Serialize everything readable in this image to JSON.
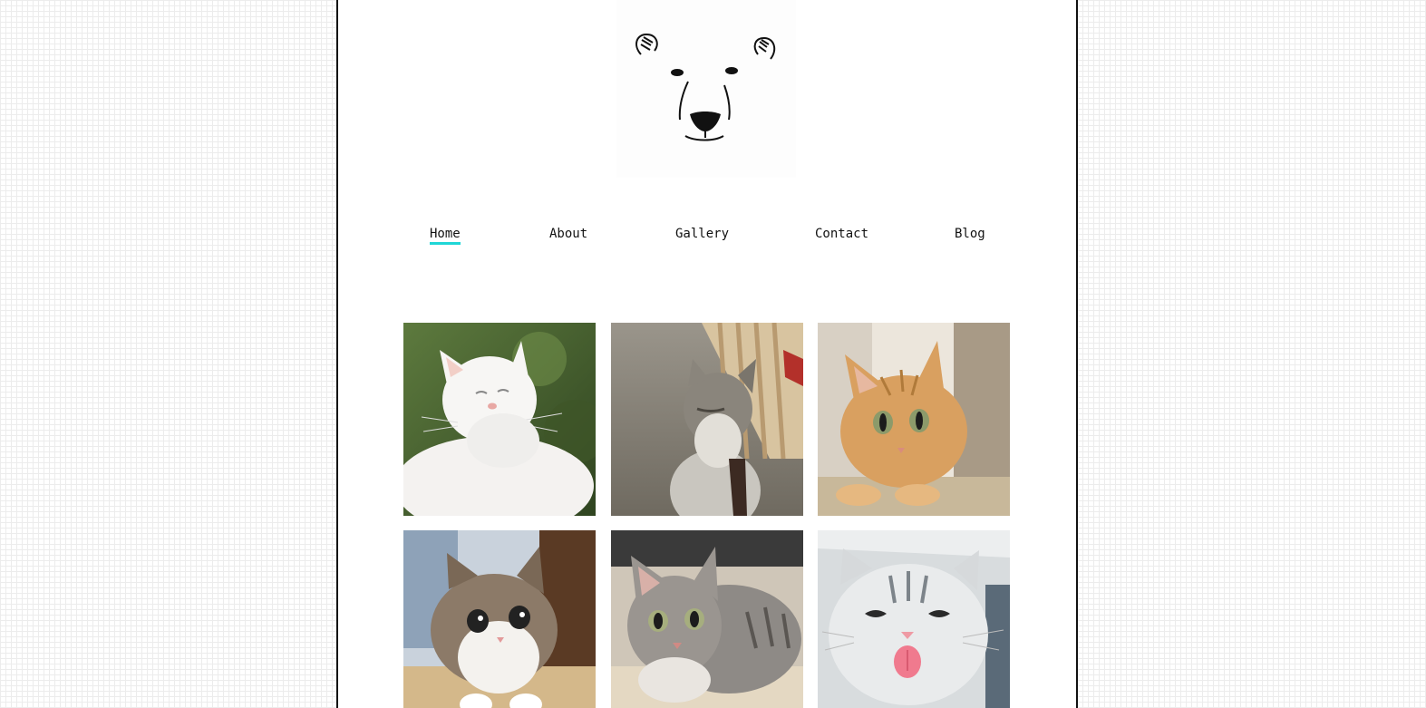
{
  "nav": {
    "items": [
      {
        "label": "Home",
        "active": true
      },
      {
        "label": "About",
        "active": false
      },
      {
        "label": "Gallery",
        "active": false
      },
      {
        "label": "Contact",
        "active": false
      },
      {
        "label": "Blog",
        "active": false
      }
    ]
  },
  "colors": {
    "nav_active_underline": "#1fd6d6",
    "page_border": "#111111",
    "background_grid": "#ececec"
  },
  "logo": {
    "icon": "polar-bear-face-icon"
  },
  "gallery": {
    "photos": [
      {
        "icon": "white-cat-photo"
      },
      {
        "icon": "grey-kitten-photo"
      },
      {
        "icon": "orange-tabby-photo"
      },
      {
        "icon": "tabby-white-cat-photo"
      },
      {
        "icon": "grey-tabby-cat-photo"
      },
      {
        "icon": "silver-cat-tongue-photo"
      }
    ]
  }
}
